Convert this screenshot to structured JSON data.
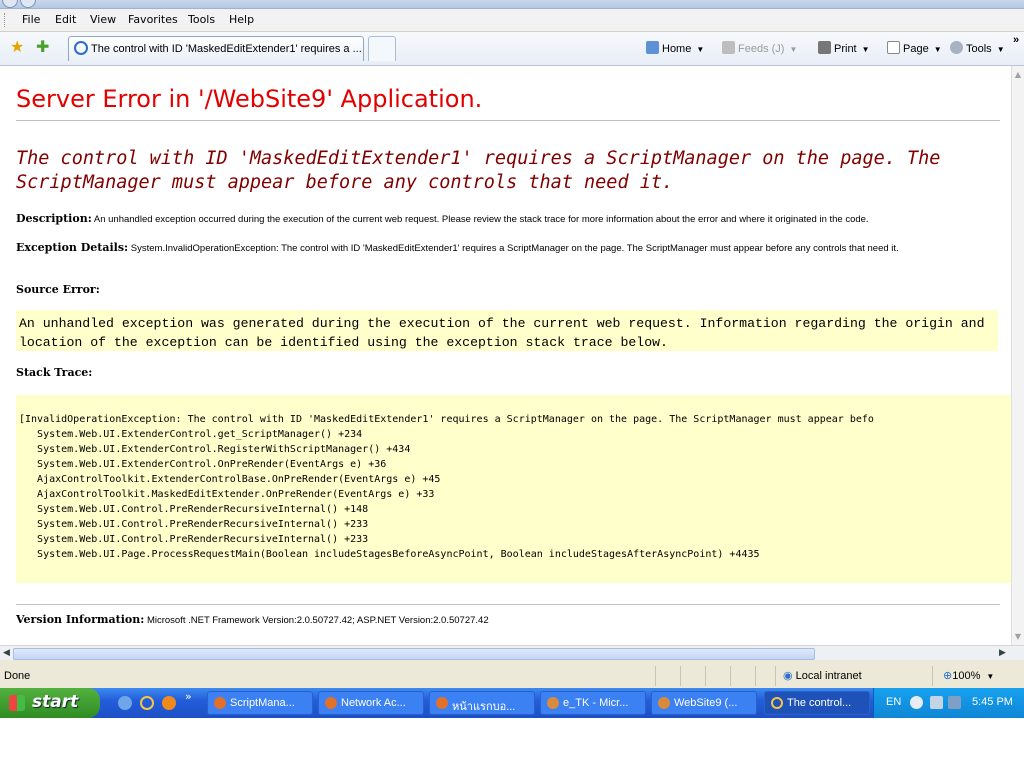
{
  "menu": [
    "File",
    "Edit",
    "View",
    "Favorites",
    "Tools",
    "Help"
  ],
  "tab": {
    "title": "The control with ID 'MaskedEditExtender1' requires a ..."
  },
  "commands": {
    "home": "Home",
    "feeds": "Feeds (J)",
    "print": "Print",
    "page": "Page",
    "tools": "Tools",
    "more": "»"
  },
  "page": {
    "heading": "Server Error in '/WebSite9' Application.",
    "message": "The control with ID 'MaskedEditExtender1' requires a ScriptManager on the page. The ScriptManager must appear before any controls that need it.",
    "description_label": "Description:",
    "description": "An unhandled exception occurred during the execution of the current web request. Please review the stack trace for more information about the error and where it originated in the code.",
    "exception_label": "Exception Details:",
    "exception": "System.InvalidOperationException: The control with ID 'MaskedEditExtender1' requires a ScriptManager on the page. The ScriptManager must appear before any controls that need it.",
    "source_error_label": "Source Error:",
    "source_error_line1": "An unhandled exception was generated during the execution of the current web request. Information regarding the origin and",
    "source_error_line2": "location of the exception can be identified using the exception stack trace below.",
    "stack_trace_label": "Stack Trace:",
    "stack_trace": [
      "[InvalidOperationException: The control with ID 'MaskedEditExtender1' requires a ScriptManager on the page. The ScriptManager must appear befo",
      "   System.Web.UI.ExtenderControl.get_ScriptManager() +234",
      "   System.Web.UI.ExtenderControl.RegisterWithScriptManager() +434",
      "   System.Web.UI.ExtenderControl.OnPreRender(EventArgs e) +36",
      "   AjaxControlToolkit.ExtenderControlBase.OnPreRender(EventArgs e) +45",
      "   AjaxControlToolkit.MaskedEditExtender.OnPreRender(EventArgs e) +33",
      "   System.Web.UI.Control.PreRenderRecursiveInternal() +148",
      "   System.Web.UI.Control.PreRenderRecursiveInternal() +233",
      "   System.Web.UI.Control.PreRenderRecursiveInternal() +233",
      "   System.Web.UI.Page.ProcessRequestMain(Boolean includeStagesBeforeAsyncPoint, Boolean includeStagesAfterAsyncPoint) +4435"
    ],
    "version_label": "Version Information:",
    "version": "Microsoft .NET Framework Version:2.0.50727.42; ASP.NET Version:2.0.50727.42"
  },
  "status": {
    "text": "Done",
    "zone": "Local intranet",
    "zoom": "100%"
  },
  "taskbar": {
    "start": "start",
    "overflow": "»",
    "tasks": [
      {
        "label": "ScriptMana..."
      },
      {
        "label": "Network Ac..."
      },
      {
        "label": "หน้าแรกบอ..."
      },
      {
        "label": "e_TK - Micr..."
      },
      {
        "label": "WebSite9 (..."
      },
      {
        "label": "The control..."
      }
    ],
    "lang": "EN",
    "clock": "5:45 PM"
  },
  "colors": {
    "heading": "#e20000",
    "message": "#800000",
    "code_bg": "#ffffcc",
    "taskbar": "#245edb",
    "start": "#3c9a2f"
  }
}
